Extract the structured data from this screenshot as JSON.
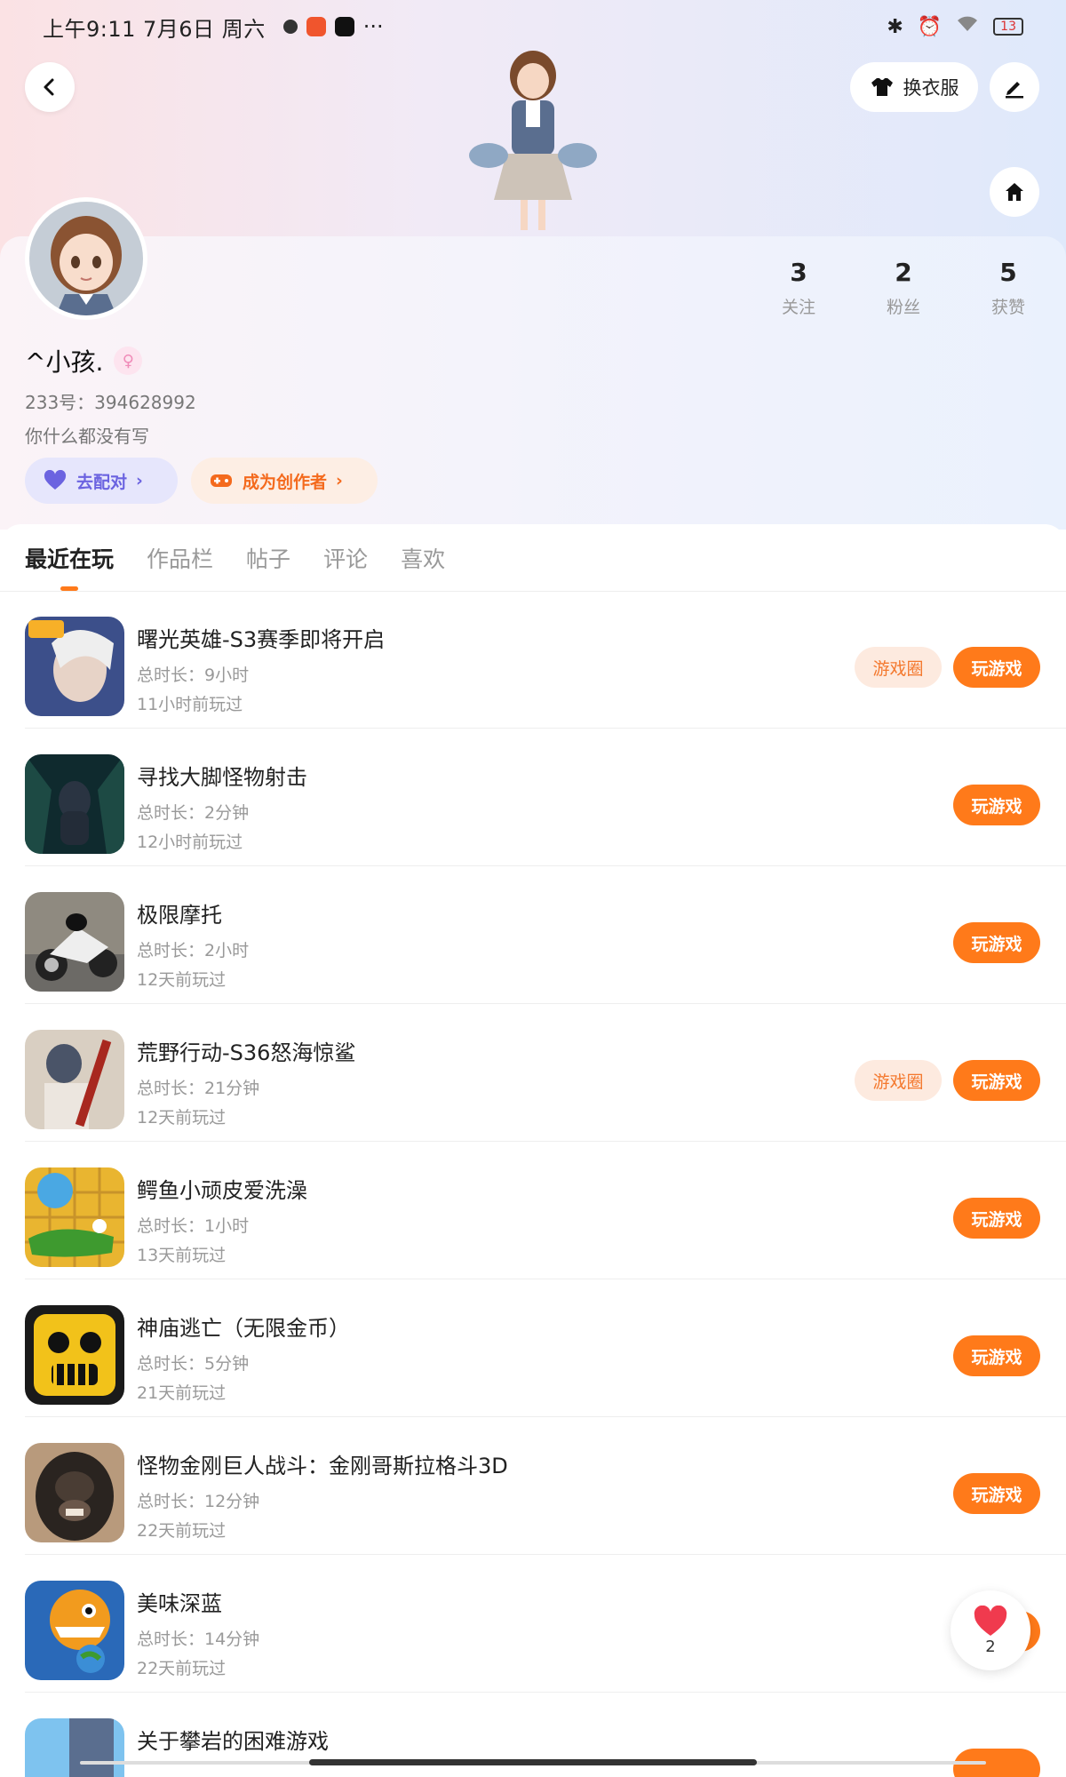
{
  "status_bar": {
    "time": "上午9:11 7月6日 周六",
    "more": "···",
    "battery": "13"
  },
  "header": {
    "outfit_label": "换衣服"
  },
  "profile": {
    "username": "^小孩.",
    "uid": "233号：394628992",
    "bio": "你什么都没有写",
    "stats": [
      {
        "num": "3",
        "label": "关注"
      },
      {
        "num": "2",
        "label": "粉丝"
      },
      {
        "num": "5",
        "label": "获赞"
      }
    ],
    "match_label": "去配对",
    "creator_label": "成为创作者"
  },
  "tabs": [
    "最近在玩",
    "作品栏",
    "帖子",
    "评论",
    "喜欢"
  ],
  "games": [
    {
      "title": "曙光英雄-S3赛季即将开启",
      "duration": "总时长：9小时",
      "last": "11小时前玩过",
      "circle": true
    },
    {
      "title": "寻找大脚怪物射击",
      "duration": "总时长：2分钟",
      "last": "12小时前玩过",
      "circle": false
    },
    {
      "title": "极限摩托",
      "duration": "总时长：2小时",
      "last": "12天前玩过",
      "circle": false
    },
    {
      "title": "荒野行动-S36怒海惊鲨",
      "duration": "总时长：21分钟",
      "last": "12天前玩过",
      "circle": true
    },
    {
      "title": "鳄鱼小顽皮爱洗澡",
      "duration": "总时长：1小时",
      "last": "13天前玩过",
      "circle": false
    },
    {
      "title": "神庙逃亡（无限金币）",
      "duration": "总时长：5分钟",
      "last": "21天前玩过",
      "circle": false
    },
    {
      "title": "怪物金刚巨人战斗：金刚哥斯拉格斗3D",
      "duration": "总时长：12分钟",
      "last": "22天前玩过",
      "circle": false
    },
    {
      "title": "美味深蓝",
      "duration": "总时长：14分钟",
      "last": "22天前玩过",
      "circle": false
    },
    {
      "title": "关于攀岩的困难游戏",
      "duration": "",
      "last": "",
      "circle": false
    }
  ],
  "buttons": {
    "circle_label": "游戏圈",
    "play_label": "玩游戏"
  },
  "float_like": {
    "count": "2"
  }
}
